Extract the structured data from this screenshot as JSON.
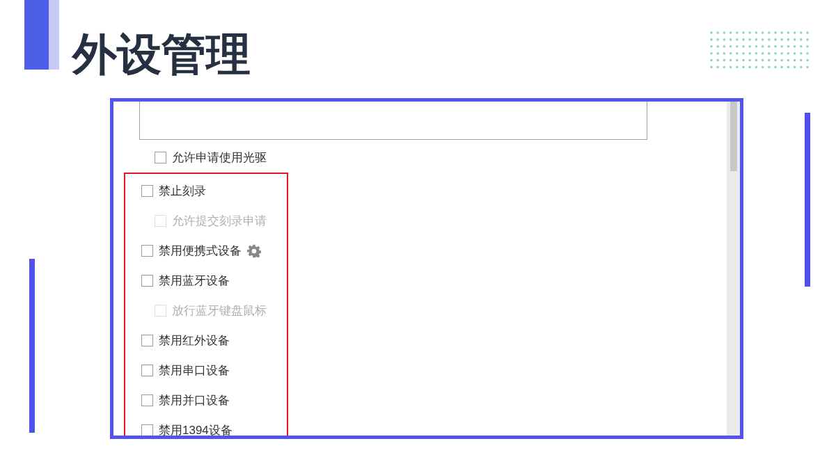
{
  "slide": {
    "title": "外设管理"
  },
  "settings_panel": {
    "preceding_options": [
      {
        "label": "允许申请使用光驱",
        "checked": false,
        "disabled": false
      }
    ],
    "highlighted_options": [
      {
        "label": "禁止刻录",
        "checked": false,
        "disabled": false,
        "children": [
          {
            "label": "允许提交刻录申请",
            "checked": false,
            "disabled": true
          }
        ]
      },
      {
        "label": "禁用便携式设备",
        "checked": false,
        "disabled": false,
        "has_settings": true
      },
      {
        "label": "禁用蓝牙设备",
        "checked": false,
        "disabled": false,
        "children": [
          {
            "label": "放行蓝牙键盘鼠标",
            "checked": false,
            "disabled": true
          }
        ]
      },
      {
        "label": "禁用红外设备",
        "checked": false,
        "disabled": false
      },
      {
        "label": "禁用串口设备",
        "checked": false,
        "disabled": false
      },
      {
        "label": "禁用并口设备",
        "checked": false,
        "disabled": false
      },
      {
        "label": "禁用1394设备",
        "checked": false,
        "disabled": false
      }
    ]
  }
}
